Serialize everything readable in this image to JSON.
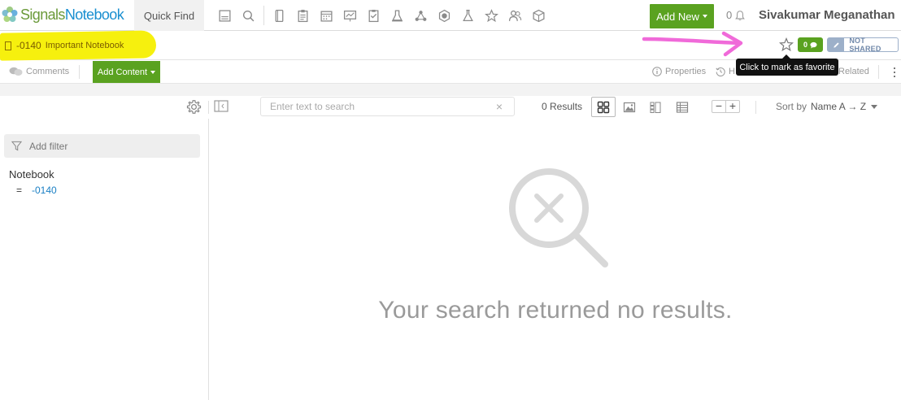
{
  "topbar": {
    "logo": {
      "part1": "Signals",
      "part2": "Notebook"
    },
    "quick_find": "Quick Find",
    "toolbar_icons": [
      "form-icon",
      "search-icon",
      "notebook-icon",
      "clipboard-icon",
      "calendar-icon",
      "presentation-icon",
      "checklist-icon",
      "lab-bench-icon",
      "network-icon",
      "hexagon-icon",
      "flask-icon",
      "star-icon",
      "users-icon",
      "cube-icon"
    ],
    "add_new": "Add New",
    "notification_count": "0",
    "user_name": "Sivakumar Meganathan"
  },
  "notebook": {
    "number": "-0140",
    "name": "Important Notebook",
    "comment_count": "0",
    "share_status": "NOT SHARED"
  },
  "tooltip": "Click to mark as favorite",
  "content_toolbar": {
    "comments": "Comments",
    "add_content": "Add Content",
    "properties": "Properties",
    "history": "H",
    "related": "Related"
  },
  "search": {
    "placeholder": "Enter text to search",
    "clear": "×",
    "results": "0 Results",
    "zoom_out": "−",
    "zoom_in": "+",
    "sort_label": "Sort by",
    "sort_value": "Name A → Z"
  },
  "filters": {
    "add_filter": "Add filter",
    "group": "Notebook",
    "operator": "=",
    "value": "-0140"
  },
  "empty_state": {
    "message": "Your search returned no results."
  },
  "colors": {
    "brand_green": "#5aa220",
    "link_blue": "#1a7fc4",
    "highlight_yellow": "#f6f00e",
    "annotation_pink": "#f06ad9"
  }
}
